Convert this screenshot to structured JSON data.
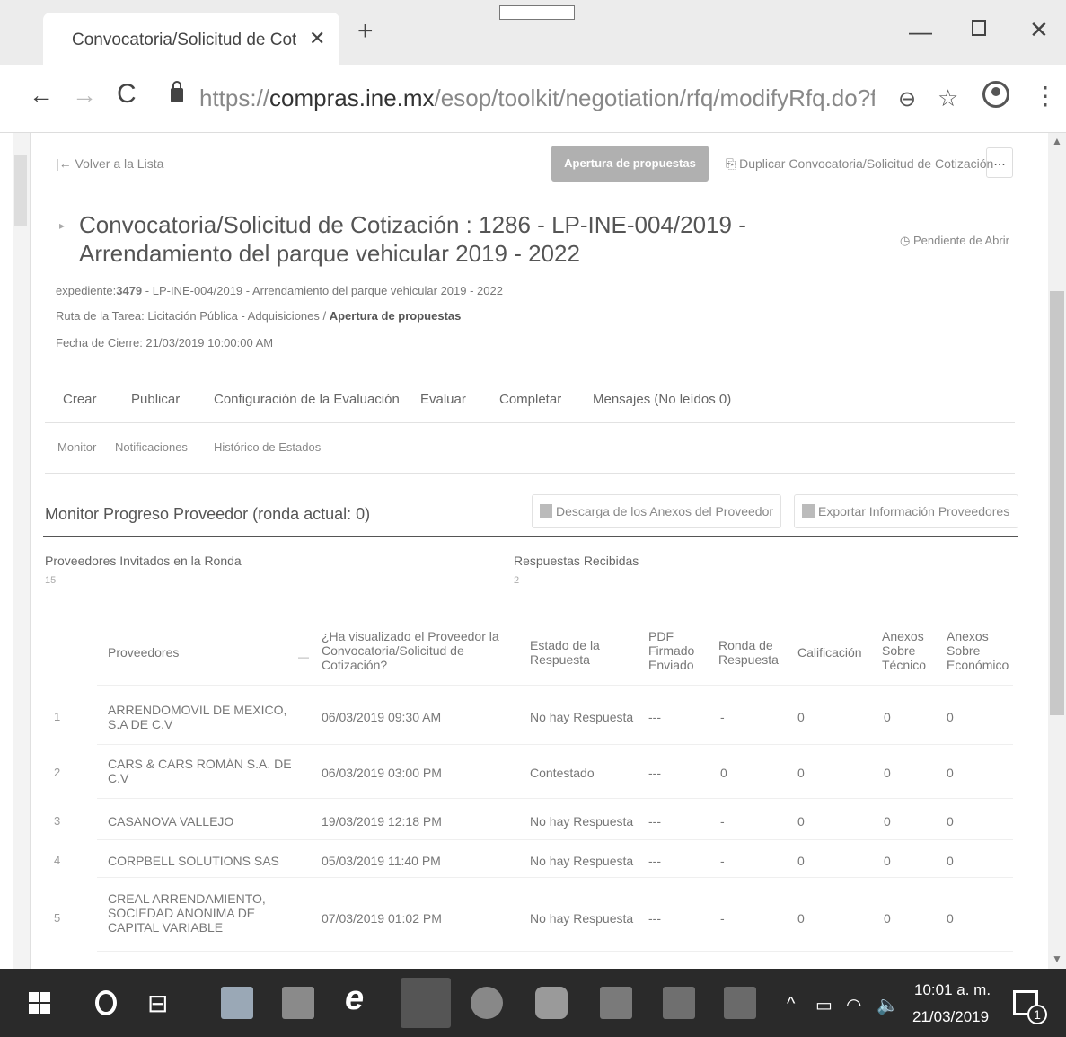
{
  "browser": {
    "tab_title": "Convocatoria/Solicitud de Cotiza",
    "url_prefix": "https://",
    "url_host": "compras.ine.mx",
    "url_path": "/esop/toolkit/negotiation/rfq/modifyRfq.do?from=menu..."
  },
  "page": {
    "back_link": "Volver a la Lista",
    "apertura_button": "Apertura de propuestas",
    "duplicate_link": "Duplicar Convocatoria/Solicitud de Cotización",
    "more_label": "...",
    "title": "Convocatoria/Solicitud de Cotización : 1286 - LP-INE-004/2019 - Arrendamiento del parque vehicular 2019 - 2022",
    "status": "Pendiente de Abrir",
    "expediente_label": "expediente:",
    "expediente_value": "3479",
    "expediente_rest": " - LP-INE-004/2019 - Arrendamiento del parque vehicular 2019 - 2022",
    "ruta_label": "Ruta de la Tarea: Licitación Pública - Adquisiciones / ",
    "ruta_value": "Apertura de propuestas",
    "fecha_cierre": "Fecha de Cierre: 21/03/2019 10:00:00 AM"
  },
  "tabs": [
    "Crear",
    "Publicar",
    "Configuración de la Evaluación",
    "Evaluar",
    "Completar",
    "Mensajes (No leídos 0)"
  ],
  "subtabs": [
    "Monitor",
    "Notificaciones",
    "Histórico de Estados"
  ],
  "monitor": {
    "title": "Monitor Progreso Proveedor (ronda actual: 0)",
    "download_button": "Descarga de los Anexos del Proveedor",
    "export_button": "Exportar Información Proveedores",
    "invited_label": "Proveedores Invitados en la Ronda",
    "invited_value": "15",
    "received_label": "Respuestas Recibidas",
    "received_value": "2"
  },
  "table": {
    "headers": {
      "proveedores": "Proveedores",
      "visualizado": "¿Ha visualizado el Proveedor la Convocatoria/Solicitud de Cotización?",
      "estado": "Estado de la Respuesta",
      "pdf": "PDF Firmado Enviado",
      "ronda": "Ronda de Respuesta",
      "calificacion": "Calificación",
      "anexos_tecnico": "Anexos Sobre Técnico",
      "anexos_economico": "Anexos Sobre Económico"
    },
    "rows": [
      {
        "num": "1",
        "proveedor": "ARRENDOMOVIL DE MEXICO, S.A DE C.V",
        "visto": "06/03/2019 09:30 AM",
        "estado": "No hay Respuesta",
        "pdf": "---",
        "ronda": "-",
        "calificacion": "0",
        "tecnico": "0",
        "economico": "0"
      },
      {
        "num": "2",
        "proveedor": "CARS & CARS ROMÁN S.A. DE C.V",
        "visto": "06/03/2019 03:00 PM",
        "estado": "Contestado",
        "pdf": "---",
        "ronda": "0",
        "calificacion": "0",
        "tecnico": "0",
        "economico": "0"
      },
      {
        "num": "3",
        "proveedor": "CASANOVA VALLEJO",
        "visto": "19/03/2019 12:18 PM",
        "estado": "No hay Respuesta",
        "pdf": "---",
        "ronda": "-",
        "calificacion": "0",
        "tecnico": "0",
        "economico": "0"
      },
      {
        "num": "4",
        "proveedor": "CORPBELL SOLUTIONS SAS",
        "visto": "05/03/2019 11:40 PM",
        "estado": "No hay Respuesta",
        "pdf": "---",
        "ronda": "-",
        "calificacion": "0",
        "tecnico": "0",
        "economico": "0"
      },
      {
        "num": "5",
        "proveedor": "CREAL ARRENDAMIENTO, SOCIEDAD ANONIMA DE CAPITAL VARIABLE",
        "visto": "07/03/2019 01:02 PM",
        "estado": "No hay Respuesta",
        "pdf": "---",
        "ronda": "-",
        "calificacion": "0",
        "tecnico": "0",
        "economico": "0"
      }
    ]
  },
  "taskbar": {
    "time": "10:01 a. m.",
    "date": "21/03/2019",
    "notifications": "1"
  }
}
